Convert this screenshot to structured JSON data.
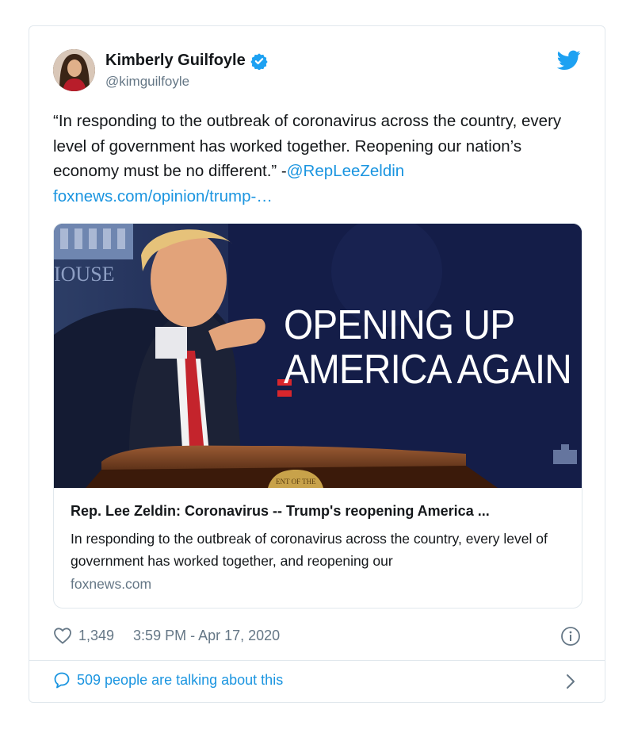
{
  "tweet": {
    "author_name": "Kimberly Guilfoyle",
    "handle": "@kimguilfoyle",
    "text_part1": "“In responding to the outbreak of coronavirus across the country, every level of government has worked together. Reopening our nation’s economy must be no different.” -",
    "mention": "@RepLeeZeldin",
    "url": "foxnews.com/opinion/trump-…",
    "likes": "1,349",
    "timestamp": "3:59 PM - Apr 17, 2020",
    "conversation": "509 people are talking about this"
  },
  "link_card": {
    "title": "Rep. Lee Zeldin: Coronavirus -- Trump's reopening America ...",
    "description": "In responding to the outbreak of coronavirus across the country, every level of government has worked together, and reopening our",
    "domain": "foxnews.com",
    "image_text_line1": "OPENING UP",
    "image_text_line2": "AMERICA AGAIN",
    "image_sign_text": "IOUSE",
    "image_seal_text": "ENT OF THE"
  },
  "icons": {
    "verified": "verified-badge-icon",
    "bird": "twitter-bird-icon",
    "heart": "heart-icon",
    "info": "info-icon",
    "bubble": "comment-bubble-icon",
    "chevron": "chevron-right-icon"
  },
  "colors": {
    "accent": "#1b95e0",
    "muted": "#657786",
    "border": "#e1e8ed",
    "text": "#14171a"
  }
}
